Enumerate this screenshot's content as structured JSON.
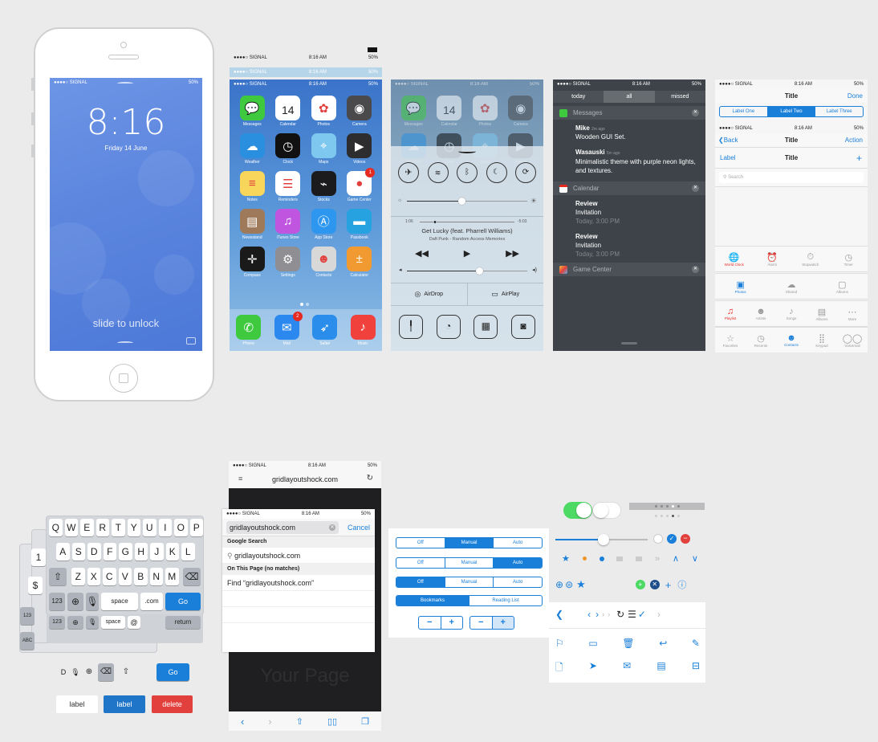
{
  "status": {
    "carrier": "●●●●○ SIGNAL",
    "time": "8:16 AM",
    "battery": "50%"
  },
  "lock": {
    "time": "8:16",
    "date": "Friday 14 June",
    "slide": "slide to unlock"
  },
  "home": {
    "apps": [
      {
        "label": "Messages",
        "color": "#3ec93f",
        "icon": "message-bubble"
      },
      {
        "label": "Calendar",
        "color": "#ffffff",
        "icon": "calendar",
        "text": "14"
      },
      {
        "label": "Photos",
        "color": "#ffffff",
        "icon": "flower"
      },
      {
        "label": "Camera",
        "color": "#4a4a4c",
        "icon": "lens"
      },
      {
        "label": "Weather",
        "color": "#2b8fe0",
        "icon": "sun-cloud"
      },
      {
        "label": "Clock",
        "color": "#111111",
        "icon": "clock"
      },
      {
        "label": "Maps",
        "color": "#7ec8f0",
        "icon": "map"
      },
      {
        "label": "Videos",
        "color": "#2d2d2f",
        "icon": "clapper"
      },
      {
        "label": "Notes",
        "color": "#f8d65c",
        "icon": "notes"
      },
      {
        "label": "Reminders",
        "color": "#ffffff",
        "icon": "list"
      },
      {
        "label": "Stocks",
        "color": "#1b1b1d",
        "icon": "graph"
      },
      {
        "label": "Game Center",
        "color": "#ffffff",
        "icon": "bubbles",
        "badge": "1"
      },
      {
        "label": "Newsstand",
        "color": "#9e7a5a",
        "icon": "shelf"
      },
      {
        "label": "iTunes Store",
        "color": "#c055e0",
        "icon": "note"
      },
      {
        "label": "App Store",
        "color": "#2d97ef",
        "icon": "a-glyph"
      },
      {
        "label": "Passbook",
        "color": "#26a2e0",
        "icon": "tickets"
      },
      {
        "label": "Compass",
        "color": "#1a1a1a",
        "icon": "compass"
      },
      {
        "label": "Settings",
        "color": "#8e8e93",
        "icon": "gear"
      },
      {
        "label": "Contacts",
        "color": "#d8d8d8",
        "icon": "person"
      },
      {
        "label": "Calculator",
        "color": "#f19a32",
        "icon": "calc"
      }
    ],
    "dock": [
      {
        "label": "Phone",
        "color": "#3ec93f",
        "icon": "phone"
      },
      {
        "label": "Mail",
        "color": "#2b88ee",
        "icon": "envelope",
        "badge": "2"
      },
      {
        "label": "Safari",
        "color": "#2a8ceb",
        "icon": "compass-needle"
      },
      {
        "label": "Music",
        "color": "#f0413c",
        "icon": "music-note"
      }
    ]
  },
  "cc": {
    "song": "Get Lucky (feat. Pharrell Williams)",
    "artist": "Daft Punk - Random Access Memories",
    "elapsed": "1:06",
    "remaining": "-5:03",
    "airdrop": "AirDrop",
    "airplay": "AirPlay",
    "brightness": 0.45,
    "progress": 0.15,
    "volume": 0.6
  },
  "notif": {
    "tabs": [
      "today",
      "all",
      "missed"
    ],
    "sections": {
      "messages": "Messages",
      "calendar": "Calendar",
      "gamecenter": "Game Center"
    },
    "items": [
      {
        "title": "Mike",
        "time": "2m ago",
        "body": "Wooden GUI Set."
      },
      {
        "title": "Wasauski",
        "time": "5m ago",
        "body": "Minimalistic theme with purple neon lights, and textures."
      }
    ],
    "events": [
      {
        "title": "Review",
        "body": "Invitation",
        "time": "Today, 3:00 PM"
      },
      {
        "title": "Review",
        "body": "Invitation",
        "time": "Today, 3:00 PM"
      }
    ]
  },
  "ctrl": {
    "title": "Title",
    "done": "Done",
    "segments": [
      "Label One",
      "Label Two",
      "Label Three"
    ],
    "back": "Back",
    "action": "Action",
    "label": "Label",
    "plus": "+",
    "search": "Search",
    "tabs1": [
      "World Clock",
      "Alarm",
      "Stopwatch",
      "Timer"
    ],
    "tabs2": [
      "Photos",
      "Shared",
      "Albums"
    ],
    "tabs3": [
      "Playlist",
      "Artists",
      "Songs",
      "Albums",
      "More"
    ],
    "tabs4": [
      "Favorites",
      "Recents",
      "Contacts",
      "Keypad",
      "Voicemail"
    ]
  },
  "keyboard": {
    "row1": [
      "Q",
      "W",
      "E",
      "R",
      "T",
      "Y",
      "U",
      "I",
      "O",
      "P"
    ],
    "row2": [
      "A",
      "S",
      "D",
      "F",
      "G",
      "H",
      "J",
      "K",
      "L"
    ],
    "row3": [
      "Z",
      "X",
      "C",
      "V",
      "B",
      "N",
      "M"
    ],
    "num": "123",
    "space": "space",
    "com": ".com",
    "go": "Go",
    "return": "return",
    "abc": "ABC",
    "back_row": [
      "1",
      "$"
    ],
    "small_keys": [
      "D"
    ],
    "label_plain": "label",
    "label_blue": "label",
    "delete": "delete"
  },
  "safari": {
    "url": "gridlayoutshock.com",
    "input": "gridlayoutshock.com",
    "cancel": "Cancel",
    "google": "Google Search",
    "suggest": "gridlayoutshock.com",
    "onpage": "On This Page (no matches)",
    "find": "Find “gridlayoutshock.com”",
    "watermark": "Your Page"
  },
  "segs": {
    "row1": [
      "Off",
      "Manual",
      "Auto"
    ],
    "row2": [
      "Off",
      "Manual",
      "Auto"
    ],
    "row3": [
      "Off",
      "Manual",
      "Auto"
    ],
    "row4": [
      "Bookmarks",
      "Reading List"
    ],
    "minus": "−",
    "plus": "+"
  },
  "accent": "#1a7fd9",
  "destructive": "#e2403c",
  "green": "#4cd964"
}
